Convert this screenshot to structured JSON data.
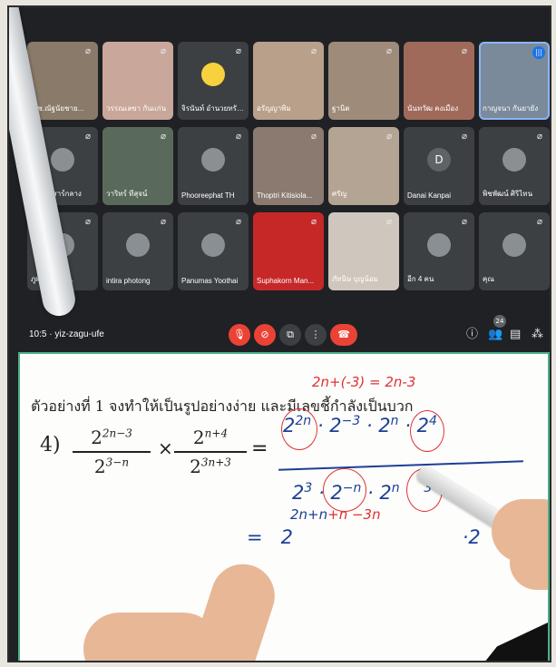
{
  "meeting": {
    "participants": [
      {
        "name": "ด.ช.ณัฐนัยชาย...",
        "avatar": "",
        "bg": "#8a7a6a",
        "active": false
      },
      {
        "name": "วรรณเลขา กันแก่น",
        "avatar": "",
        "bg": "#c9a79a",
        "active": false
      },
      {
        "name": "จิรนันท์ อำนวยทรัพย์",
        "avatar": "duck",
        "bg": "#3c4043",
        "active": false
      },
      {
        "name": "อรัญญาพิม",
        "avatar": "",
        "bg": "#b9a08a",
        "active": false
      },
      {
        "name": "ฐานิต",
        "avatar": "",
        "bg": "#9e8b7a",
        "active": false
      },
      {
        "name": "นันทวัฒ คงเมือง",
        "avatar": "",
        "bg": "#a06a5a",
        "active": false
      },
      {
        "name": "กาญจนา กันยายัง",
        "avatar": "",
        "bg": "#7a8a9a",
        "active": true
      },
      {
        "name": "ภูธาร เสาร์กลาง",
        "avatar": "",
        "bg": "#3c4043",
        "active": false
      },
      {
        "name": "วาริทร์ ทีสุจน์",
        "avatar": "",
        "bg": "#5a6a5a",
        "active": false
      },
      {
        "name": "Phooreephat TH",
        "avatar": "",
        "bg": "#3c4043",
        "active": false
      },
      {
        "name": "Thoptri Kitisiola...",
        "avatar": "",
        "bg": "#8a7a6f",
        "active": false
      },
      {
        "name": "ศรัญ",
        "avatar": "",
        "bg": "#b4a493",
        "active": false
      },
      {
        "name": "Danai Kanpai",
        "avatar": "D",
        "bg": "#3c4043",
        "active": false
      },
      {
        "name": "พิชพัฒน์ ศิริไทน",
        "avatar": "",
        "bg": "#3c4043",
        "active": false
      },
      {
        "name": "ภูผ์ลี วงศ์พา...",
        "avatar": "",
        "bg": "#3c4043",
        "active": false
      },
      {
        "name": "intira photong",
        "avatar": "",
        "bg": "#3c4043",
        "active": false
      },
      {
        "name": "Panumas Yoothai",
        "avatar": "",
        "bg": "#3c4043",
        "active": false
      },
      {
        "name": "Suphakorn Man...",
        "avatar": "",
        "bg": "#c62828",
        "active": false
      },
      {
        "name": "ภัทนิษ บุญน้อม",
        "avatar": "",
        "bg": "#cfc7bd",
        "active": false
      },
      {
        "name": "อีก 4 คน",
        "avatar": "",
        "bg": "#3c4043",
        "active": false
      },
      {
        "name": "คุณ",
        "avatar": "",
        "bg": "#3c4043",
        "active": false
      }
    ],
    "clock": "10:5",
    "meeting_code": "yiz-zagu-ufe",
    "participant_count": "24",
    "accent": "#ea4335"
  },
  "whiteboard": {
    "heading": "ตัวอย่างที่ 1 จงทำให้เป็นรูปอย่างง่าย และมีเลขชี้กำลังเป็นบวก",
    "red_note": "2n+(-3) = 2n-3",
    "step_label": "4)",
    "frac1_num_base": "2",
    "frac1_num_exp": "2n−3",
    "frac1_den_base": "2",
    "frac1_den_exp": "3−n",
    "frac2_num_base": "2",
    "frac2_num_exp": "n+4",
    "frac2_den_base": "2",
    "frac2_den_exp": "3n+3",
    "times": "×",
    "equals": "=",
    "hw_num": [
      "2",
      "2n",
      "·",
      "2",
      "−3",
      "·",
      "2",
      "n",
      "·",
      "2",
      "4"
    ],
    "hw_den": [
      "2",
      "3",
      "·",
      "2",
      "−n",
      "·",
      "2",
      "n",
      "3"
    ],
    "hw_res_eq": "=",
    "hw_res_base": "2",
    "hw_res_exp_blue": "2n+n",
    "hw_res_exp_red": "+n −3n",
    "hw_res_tail": "·2"
  }
}
